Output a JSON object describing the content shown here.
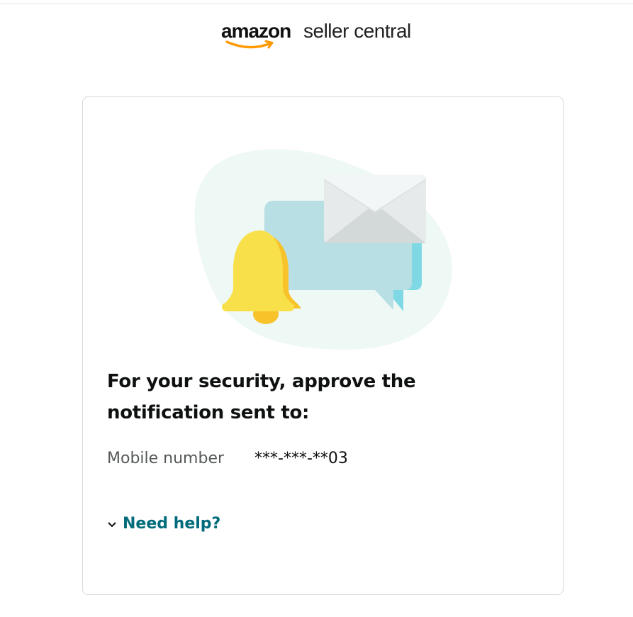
{
  "header": {
    "logo_brand": "amazon",
    "logo_product": "seller central"
  },
  "card": {
    "heading": "For your security, approve the notification sent to:",
    "mobile_label": "Mobile number",
    "mobile_value": "***-***-**03",
    "help_label": "Need help?"
  },
  "icons": {
    "illustration": "notification-illustration-icon",
    "chevron": "chevron-down-icon",
    "logo_smile": "amazon-smile-icon"
  },
  "colors": {
    "link": "#006b7a",
    "text": "#0f1111",
    "secondary_text": "#565959",
    "brand_orange": "#ff9900"
  }
}
